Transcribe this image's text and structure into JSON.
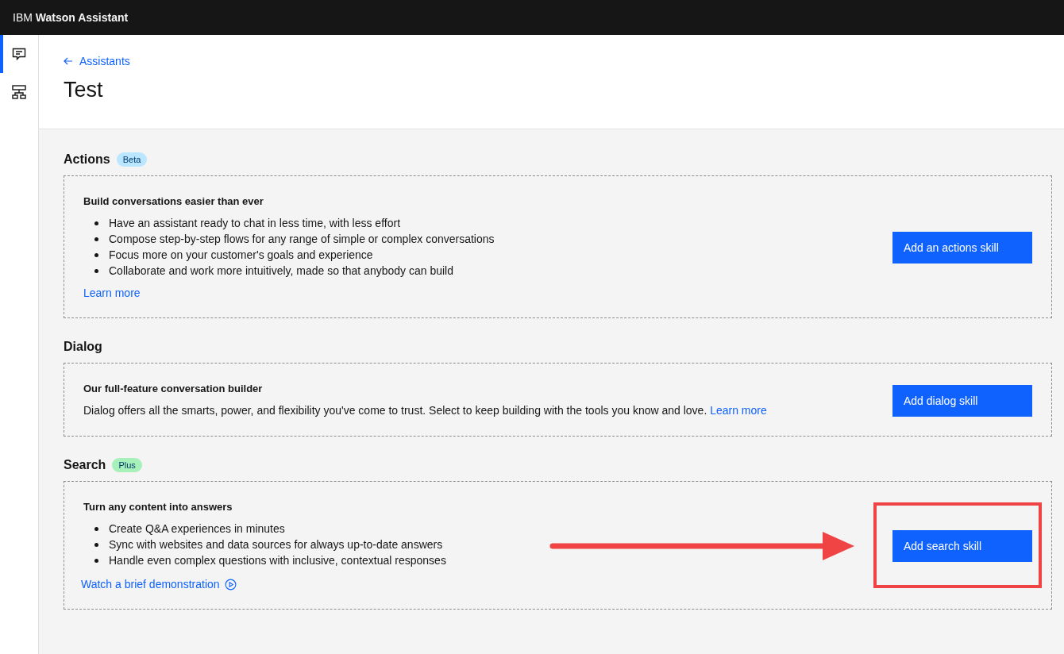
{
  "header": {
    "title": "IBM **Watson Assistant**"
  },
  "sidebar": {
    "items": [
      {
        "kind": "chat",
        "selected": true
      },
      {
        "kind": "flow",
        "selected": false
      }
    ]
  },
  "breadcrumb": {
    "label": "Assistants"
  },
  "page_title": "Test",
  "sections": [
    {
      "title": "Actions",
      "tag": {
        "label": "Beta",
        "color": "#bae6ff"
      },
      "heading": "Build conversations easier than ever",
      "bullets": [
        "Have an assistant ready to chat in less time, with less effort",
        "Compose step-by-step flows for any range of simple or complex conversations",
        "Focus more on your customer's goals and experience",
        "Collaborate and work more intuitively, made so that anybody can build"
      ],
      "link": {
        "label": "Learn more",
        "kind": "plain"
      },
      "button": "Add an actions skill",
      "annotated": false
    },
    {
      "title": "Dialog",
      "heading": "Our full-feature conversation builder",
      "description": "Dialog offers all the smarts, power, and flexibility you've come to trust. Select to keep building with the tools you know and love.",
      "inline_link": "Learn more",
      "button": "Add dialog skill",
      "annotated": false
    },
    {
      "title": "Search",
      "tag": {
        "label": "Plus",
        "color": "#a7f0ba"
      },
      "heading": "Turn any content into answers",
      "bullets": [
        "Create Q&A experiences in minutes",
        "Sync with websites and data sources for always up-to-date answers",
        "Handle even complex questions with inclusive, contextual responses"
      ],
      "link": {
        "label": "Watch a brief demonstration",
        "kind": "video"
      },
      "button": "Add search skill",
      "annotated": true
    }
  ]
}
